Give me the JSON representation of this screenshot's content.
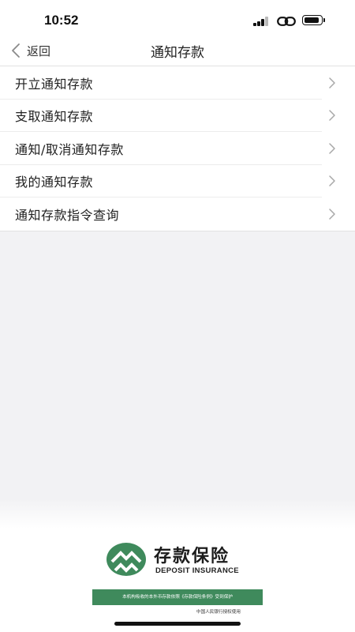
{
  "status_bar": {
    "time": "10:52"
  },
  "nav": {
    "back_label": "返回",
    "title": "通知存款"
  },
  "menu": {
    "items": [
      {
        "label": "开立通知存款"
      },
      {
        "label": "支取通知存款"
      },
      {
        "label": "通知/取消通知存款"
      },
      {
        "label": "我的通知存款"
      },
      {
        "label": "通知存款指令查询"
      }
    ]
  },
  "footer": {
    "brand_title": "存款保险",
    "brand_subtitle": "DEPOSIT INSURANCE",
    "banner_text": "本机构吸收的本外币存款依照《存款保险条例》受到保护",
    "note": "中国人民银行授权使用",
    "brand_color": "#3f8a5c"
  },
  "icons": {
    "back": "chevron-left-icon",
    "item_arrow": "chevron-right-icon",
    "signal": "cellular-signal-icon",
    "link": "personal-hotspot-link-icon",
    "battery": "battery-icon",
    "logo": "deposit-insurance-logo-icon"
  }
}
